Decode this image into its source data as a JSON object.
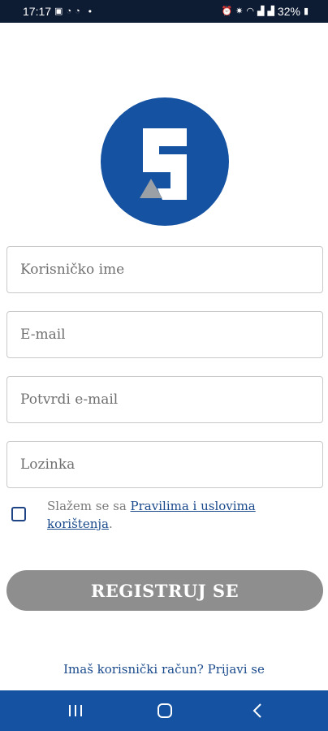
{
  "status_bar": {
    "time": "17:17",
    "left_icons": [
      "image-icon",
      "viber-icon",
      "viber-icon",
      "notification-dot"
    ],
    "right_icons": [
      "alarm-icon",
      "vibrate-icon",
      "wifi-icon",
      "signal-icon",
      "signal-icon"
    ],
    "battery": "32%"
  },
  "brand": {
    "logo_icon": "brand-s-logo",
    "primary_color": "#1552a1"
  },
  "form": {
    "username_placeholder": "Korisničko ime",
    "email_placeholder": "E-mail",
    "confirm_email_placeholder": "Potvrdi e-mail",
    "password_placeholder": "Lozinka",
    "terms_prefix": "Slažem se sa ",
    "terms_link": "Pravilima i uslovima korištenja",
    "terms_suffix": ".",
    "terms_checked": false,
    "register_label": "REGISTRUJ SE",
    "login_prompt": "Imaš korisnički račun? Prijavi se"
  },
  "nav_bar": {
    "buttons": [
      "recent-apps-icon",
      "home-icon",
      "back-icon"
    ]
  }
}
